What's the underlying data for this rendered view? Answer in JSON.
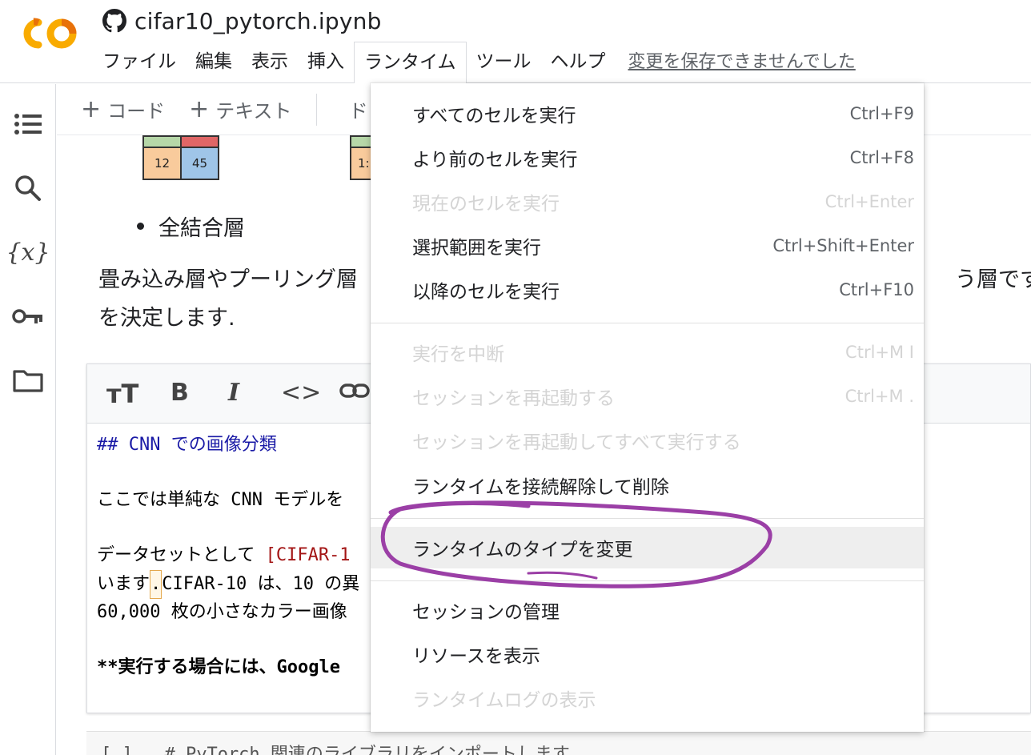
{
  "header": {
    "title": "cifar10_pytorch.ipynb",
    "menu": [
      "ファイル",
      "編集",
      "表示",
      "挿入",
      "ランタイム",
      "ツール",
      "ヘルプ"
    ],
    "active_menu_index": 4,
    "save_warning": "変更を保存できませんでした"
  },
  "toolbar": {
    "add_code_label": "コード",
    "add_text_label": "テキスト",
    "partial_label": "ド"
  },
  "notebook": {
    "grid_left": [
      "",
      "",
      "12",
      "45"
    ],
    "grid_right_partial": "1:",
    "bullet_text": "全結合層",
    "para_line1": "畳み込み層やプーリング層",
    "para_line1_tail": "う層です.",
    "para_line2": "を決定します.",
    "md_lines": {
      "l1": "## CNN での画像分類",
      "l2": "ここでは単純な CNN モデルを",
      "l3_a": "データセットとして ",
      "l3_link": "[CIFAR-1",
      "l4_a": "います",
      "l4_cursor": ".",
      "l4_b": "CIFAR-10 は、10 の",
      "l4_trunc": "異",
      "l5": "60,000 枚の小さなカラー画像",
      "l6": "**実行する場合には、Google"
    },
    "code_line": "[ ]   # PyTorch 関連のライブラリをインポートします"
  },
  "runtime_menu": {
    "items": [
      {
        "label": "すべてのセルを実行",
        "shortcut": "Ctrl+F9",
        "disabled": false
      },
      {
        "label": "より前のセルを実行",
        "shortcut": "Ctrl+F8",
        "disabled": false
      },
      {
        "label": "現在のセルを実行",
        "shortcut": "Ctrl+Enter",
        "disabled": true
      },
      {
        "label": "選択範囲を実行",
        "shortcut": "Ctrl+Shift+Enter",
        "disabled": false
      },
      {
        "label": "以降のセルを実行",
        "shortcut": "Ctrl+F10",
        "disabled": false
      },
      {
        "label": "実行を中断",
        "shortcut": "Ctrl+M I",
        "disabled": true
      },
      {
        "label": "セッションを再起動する",
        "shortcut": "Ctrl+M .",
        "disabled": true
      },
      {
        "label": "セッションを再起動してすべて実行する",
        "shortcut": "",
        "disabled": true
      },
      {
        "label": "ランタイムを接続解除して削除",
        "shortcut": "",
        "disabled": false
      },
      {
        "label": "ランタイムのタイプを変更",
        "shortcut": "",
        "disabled": false,
        "highlighted": true
      },
      {
        "label": "セッションの管理",
        "shortcut": "",
        "disabled": false
      },
      {
        "label": "リソースを表示",
        "shortcut": "",
        "disabled": false
      },
      {
        "label": "ランタイムログの表示",
        "shortcut": "",
        "disabled": true
      }
    ]
  },
  "colors": {
    "logo_orange": "#F9AB00",
    "logo_dark_orange": "#E8710A",
    "annotation": "#9b3fa6",
    "grid_green": "#b6d7a8",
    "grid_red": "#e06666",
    "grid_orange": "#f9cb9c",
    "grid_blue": "#9fc5e8"
  }
}
